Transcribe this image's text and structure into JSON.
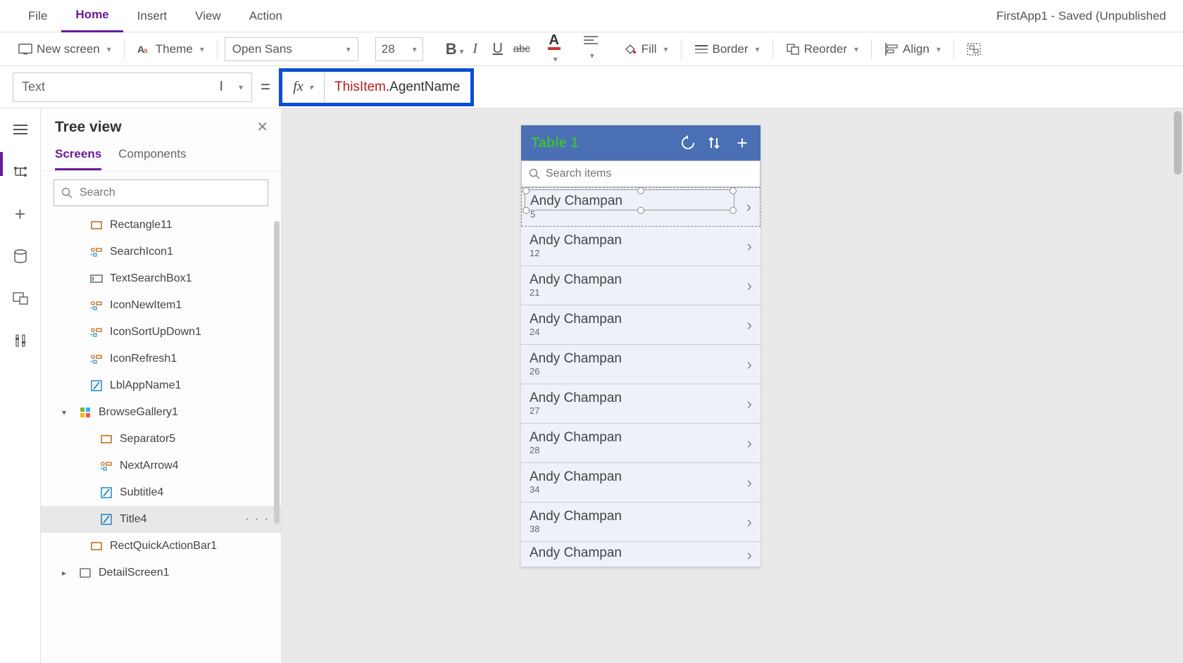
{
  "app_title": "FirstApp1 - Saved (Unpublished",
  "menu": {
    "file": "File",
    "home": "Home",
    "insert": "Insert",
    "view": "View",
    "action": "Action"
  },
  "ribbon": {
    "new_screen": "New screen",
    "theme": "Theme",
    "font": "Open Sans",
    "size": "28",
    "fill": "Fill",
    "border": "Border",
    "reorder": "Reorder",
    "align": "Align"
  },
  "property_selector": "Text",
  "formula": {
    "token1": "ThisItem",
    "token2": ".AgentName"
  },
  "tree": {
    "title": "Tree view",
    "tabs": {
      "screens": "Screens",
      "components": "Components"
    },
    "search_placeholder": "Search",
    "items": [
      {
        "label": "Rectangle11",
        "icon": "rect",
        "indent": 1
      },
      {
        "label": "SearchIcon1",
        "icon": "grp",
        "indent": 1
      },
      {
        "label": "TextSearchBox1",
        "icon": "input",
        "indent": 1
      },
      {
        "label": "IconNewItem1",
        "icon": "grp",
        "indent": 1
      },
      {
        "label": "IconSortUpDown1",
        "icon": "grp",
        "indent": 1
      },
      {
        "label": "IconRefresh1",
        "icon": "grp",
        "indent": 1
      },
      {
        "label": "LblAppName1",
        "icon": "label",
        "indent": 1
      },
      {
        "label": "BrowseGallery1",
        "icon": "gallery",
        "indent": 0,
        "expand": "open"
      },
      {
        "label": "Separator5",
        "icon": "rect",
        "indent": 2
      },
      {
        "label": "NextArrow4",
        "icon": "grp",
        "indent": 2
      },
      {
        "label": "Subtitle4",
        "icon": "label",
        "indent": 2
      },
      {
        "label": "Title4",
        "icon": "label",
        "indent": 2,
        "selected": true
      },
      {
        "label": "RectQuickActionBar1",
        "icon": "rect",
        "indent": 1
      },
      {
        "label": "DetailScreen1",
        "icon": "screen",
        "indent": 0,
        "expand": "closed"
      }
    ]
  },
  "preview": {
    "header_title": "Table 1",
    "search_placeholder": "Search items",
    "rows": [
      {
        "title": "Andy Champan",
        "sub": "5",
        "selected": true
      },
      {
        "title": "Andy Champan",
        "sub": "12"
      },
      {
        "title": "Andy Champan",
        "sub": "21"
      },
      {
        "title": "Andy Champan",
        "sub": "24"
      },
      {
        "title": "Andy Champan",
        "sub": "26"
      },
      {
        "title": "Andy Champan",
        "sub": "27"
      },
      {
        "title": "Andy Champan",
        "sub": "28"
      },
      {
        "title": "Andy Champan",
        "sub": "34"
      },
      {
        "title": "Andy Champan",
        "sub": "38"
      },
      {
        "title": "Andy Champan",
        "sub": ""
      }
    ]
  }
}
